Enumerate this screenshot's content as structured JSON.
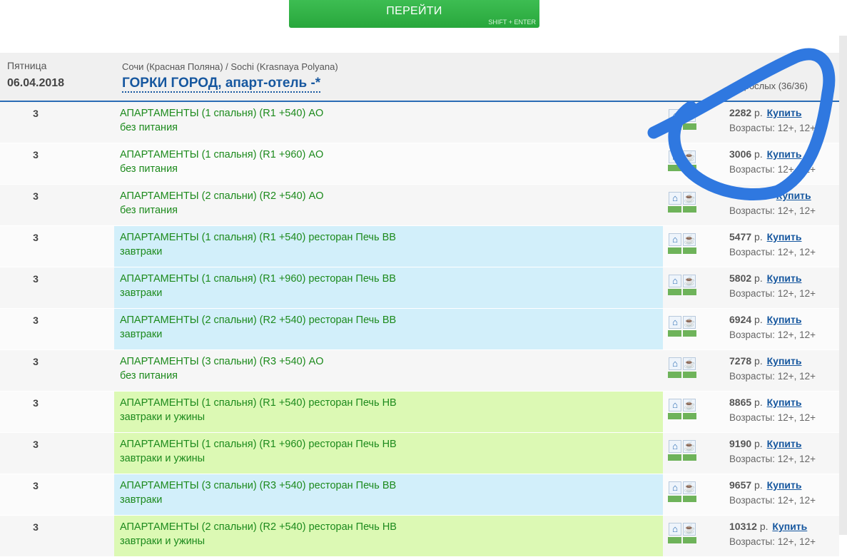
{
  "go_button": {
    "label": "ПЕРЕЙТИ",
    "hint": "SHIFT + ENTER"
  },
  "header": {
    "day_of_week": "Пятница",
    "date": "06.04.2018",
    "location": "Сочи (Красная Поляна) / Sochi (Krasnaya Polyana)",
    "hotel": "ГОРКИ ГОРОД, апарт-отель -*",
    "adults": "взрослых (36/36)"
  },
  "annotation_color": "#2f78e0",
  "price_currency": "р.",
  "buy_label": "Купить",
  "rows": [
    {
      "qty": "3",
      "name": "АПАРТАМЕНТЫ (1 спальня) (R1 +540) AO",
      "meal": "без питания",
      "price": "2282",
      "ages": "Возрасты: 12+, 12+",
      "bg": "none"
    },
    {
      "qty": "3",
      "name": "АПАРТАМЕНТЫ (1 спальня) (R1 +960) AO",
      "meal": "без питания",
      "price": "3006",
      "ages": "Возрасты: 12+, 12+",
      "bg": "none"
    },
    {
      "qty": "3",
      "name": "АПАРТАМЕНТЫ (2 спальни) (R2 +540) AO",
      "meal": "без питания",
      "price": "",
      "ages": "Возрасты: 12+, 12+",
      "bg": "none"
    },
    {
      "qty": "3",
      "name": "АПАРТАМЕНТЫ (1 спальня) (R1 +540) ресторан Печь BB",
      "meal": "завтраки",
      "price": "5477",
      "ages": "Возрасты: 12+, 12+",
      "bg": "blue"
    },
    {
      "qty": "3",
      "name": "АПАРТАМЕНТЫ (1 спальня) (R1 +960) ресторан Печь BB",
      "meal": "завтраки",
      "price": "5802",
      "ages": "Возрасты: 12+, 12+",
      "bg": "blue"
    },
    {
      "qty": "3",
      "name": "АПАРТАМЕНТЫ (2 спальни) (R2 +540) ресторан Печь BB",
      "meal": "завтраки",
      "price": "6924",
      "ages": "Возрасты: 12+, 12+",
      "bg": "blue"
    },
    {
      "qty": "3",
      "name": "АПАРТАМЕНТЫ (3 спальни) (R3 +540) AO",
      "meal": "без питания",
      "price": "7278",
      "ages": "Возрасты: 12+, 12+",
      "bg": "none"
    },
    {
      "qty": "3",
      "name": "АПАРТАМЕНТЫ (1 спальня) (R1 +540) ресторан Печь HB",
      "meal": "завтраки и ужины",
      "price": "8865",
      "ages": "Возрасты: 12+, 12+",
      "bg": "green"
    },
    {
      "qty": "3",
      "name": "АПАРТАМЕНТЫ (1 спальня) (R1 +960) ресторан Печь HB",
      "meal": "завтраки и ужины",
      "price": "9190",
      "ages": "Возрасты: 12+, 12+",
      "bg": "green"
    },
    {
      "qty": "3",
      "name": "АПАРТАМЕНТЫ (3 спальни) (R3 +540) ресторан Печь BB",
      "meal": "завтраки",
      "price": "9657",
      "ages": "Возрасты: 12+, 12+",
      "bg": "blue"
    },
    {
      "qty": "3",
      "name": "АПАРТАМЕНТЫ (2 спальни) (R2 +540) ресторан Печь HB",
      "meal": "завтраки и ужины",
      "price": "10312",
      "ages": "Возрасты: 12+, 12+",
      "bg": "green"
    }
  ]
}
